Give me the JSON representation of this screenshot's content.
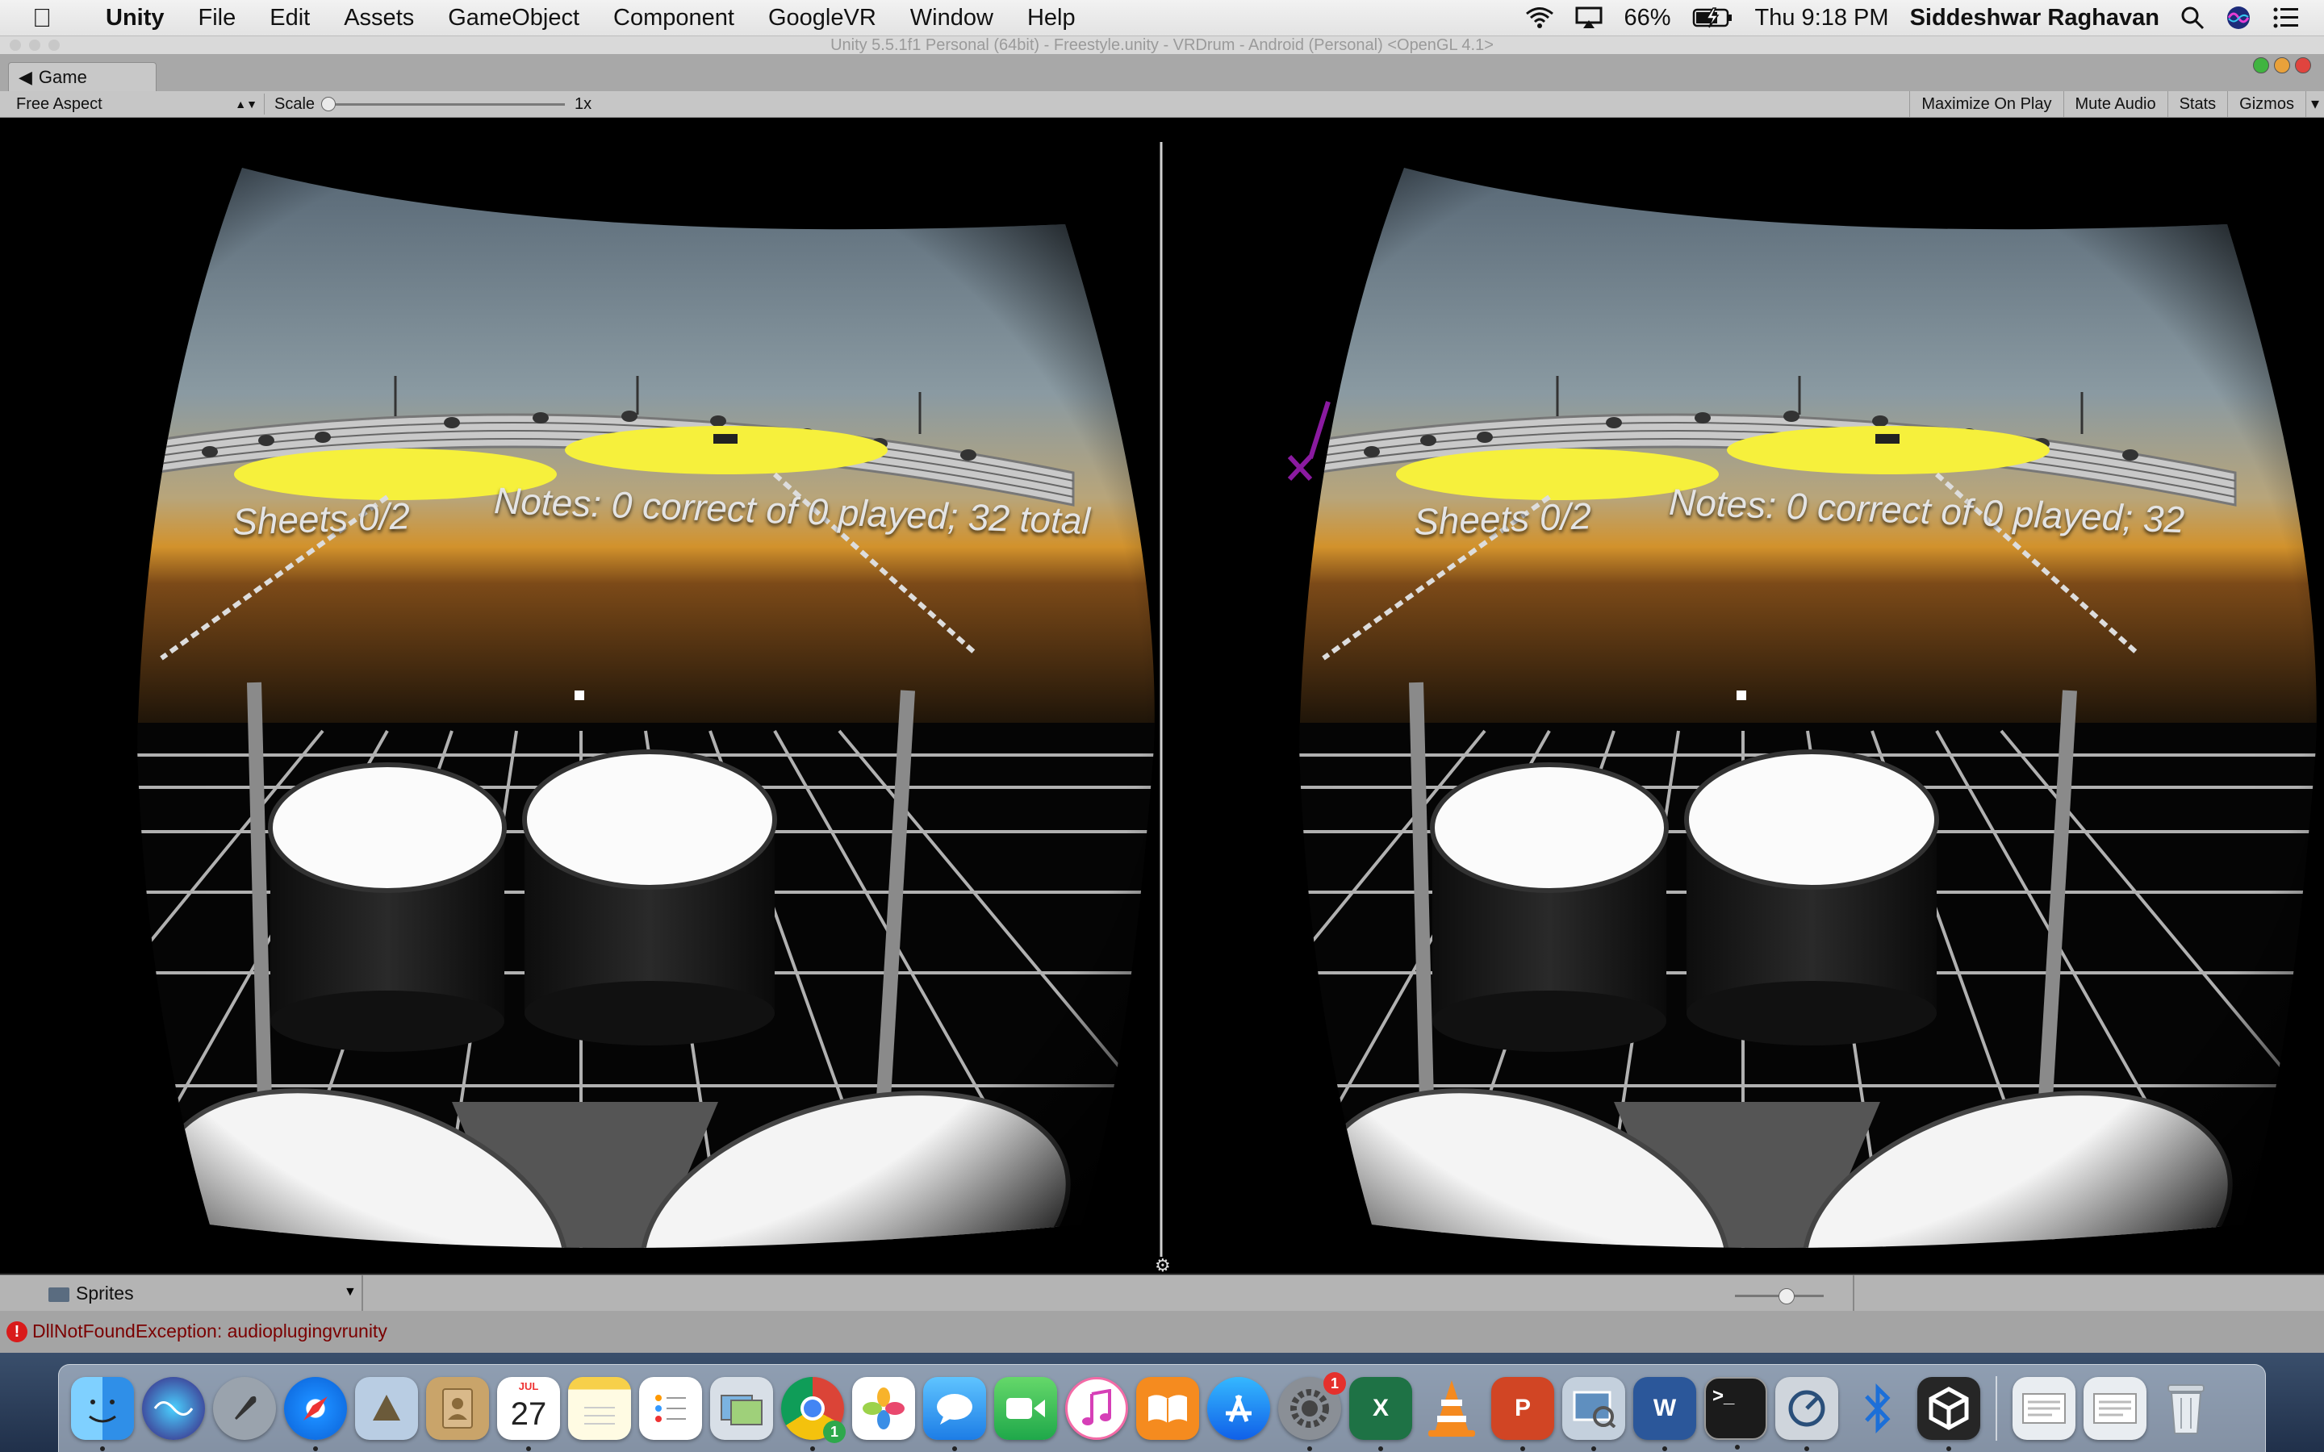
{
  "menubar": {
    "app_name": "Unity",
    "menus": [
      "File",
      "Edit",
      "Assets",
      "GameObject",
      "Component",
      "GoogleVR",
      "Window",
      "Help"
    ],
    "battery": "66%",
    "clock": "Thu 9:18 PM",
    "user": "Siddeshwar Raghavan"
  },
  "window": {
    "title": "Unity 5.5.1f1 Personal (64bit) - Freestyle.unity - VRDrum - Android (Personal) <OpenGL 4.1>"
  },
  "game_tab": {
    "label": "Game"
  },
  "toolbar": {
    "aspect": "Free Aspect",
    "scale_label": "Scale",
    "scale_value": "1x",
    "maximize_on_play": "Maximize On Play",
    "mute_audio": "Mute Audio",
    "stats": "Stats",
    "gizmos": "Gizmos"
  },
  "game": {
    "left_eye": {
      "sheets": "Sheets 0/2",
      "notes": "Notes: 0 correct of 0 played; 32 total"
    },
    "right_eye": {
      "sheets": "Sheets 0/2",
      "notes": "Notes: 0 correct of 0 played; 32"
    },
    "cymbal_color": "#f6f03c"
  },
  "project": {
    "folder": "Sprites"
  },
  "console": {
    "error": "DllNotFoundException: audioplugingvrunity"
  },
  "dock": {
    "calendar_month": "JUL",
    "calendar_day": "27",
    "chrome_badge": "1",
    "prefs_badge": "1",
    "excel_letter": "X",
    "powerpoint_letter": "P",
    "word_letter": "W",
    "terminal_prompt": ">_"
  }
}
